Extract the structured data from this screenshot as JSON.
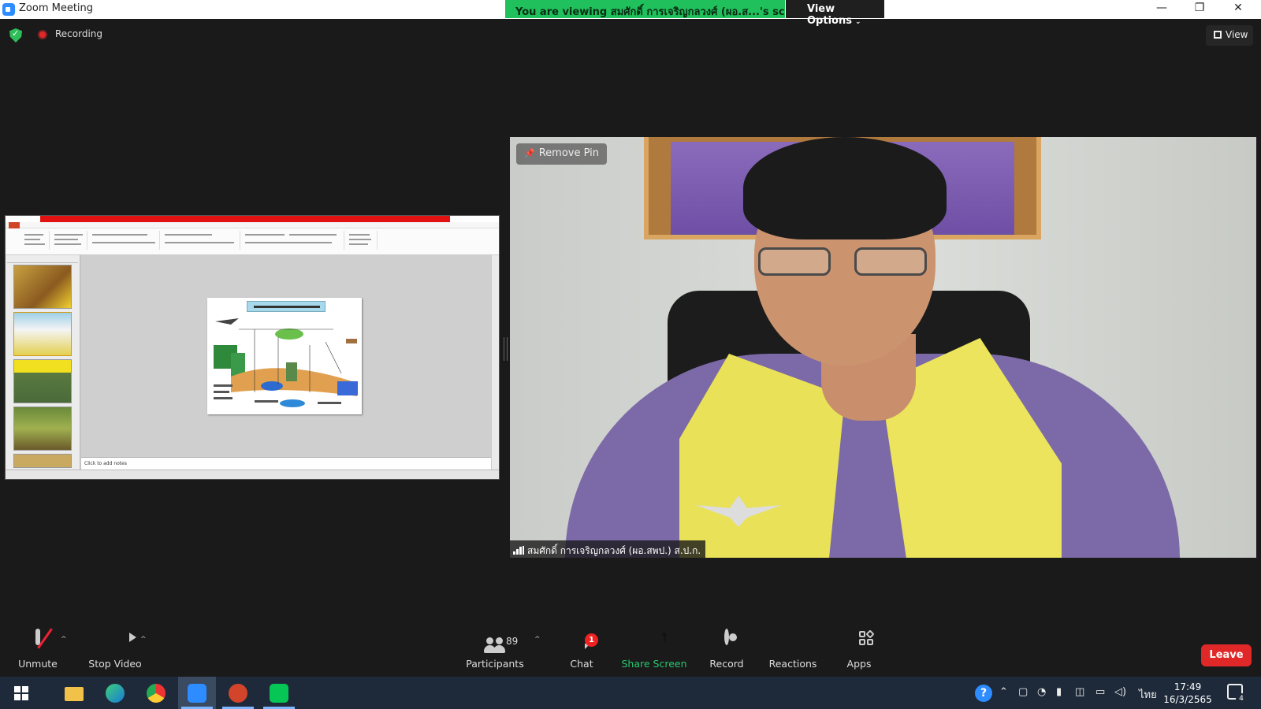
{
  "window": {
    "title": "Zoom Meeting",
    "viewing_banner": "You are viewing สมศักดิ์ การเจริญกลวงศ์ (ผอ.ส...'s screen",
    "view_options": "View Options",
    "controls": {
      "minimize": "—",
      "restore": "❐",
      "close": "✕"
    }
  },
  "meeting_top": {
    "recording_label": "Recording",
    "view_label": "View"
  },
  "shared_screen": {
    "notes_placeholder": "Click to add notes"
  },
  "video": {
    "remove_pin": "Remove Pin",
    "participant_name": "สมศักดิ์ การเจริญกลวงศ์ (ผอ.สพป.) ส.ป.ก."
  },
  "toolbar": {
    "unmute": "Unmute",
    "stop_video": "Stop Video",
    "participants_count": "89",
    "participants": "Participants",
    "chat": "Chat",
    "chat_badge": "1",
    "share_screen": "Share Screen",
    "record": "Record",
    "reactions": "Reactions",
    "apps": "Apps",
    "leave": "Leave"
  },
  "taskbar": {
    "language": "ไทย",
    "time": "17:49",
    "date": "16/3/2565",
    "notification_count": "4",
    "apps": [
      "windows-start",
      "file-explorer",
      "edge",
      "chrome",
      "zoom",
      "powerpoint",
      "line"
    ]
  },
  "colors": {
    "banner_green": "#20c05c",
    "share_green": "#28c76f",
    "leave_red": "#e02828",
    "zoom_blue": "#2d8cff"
  }
}
